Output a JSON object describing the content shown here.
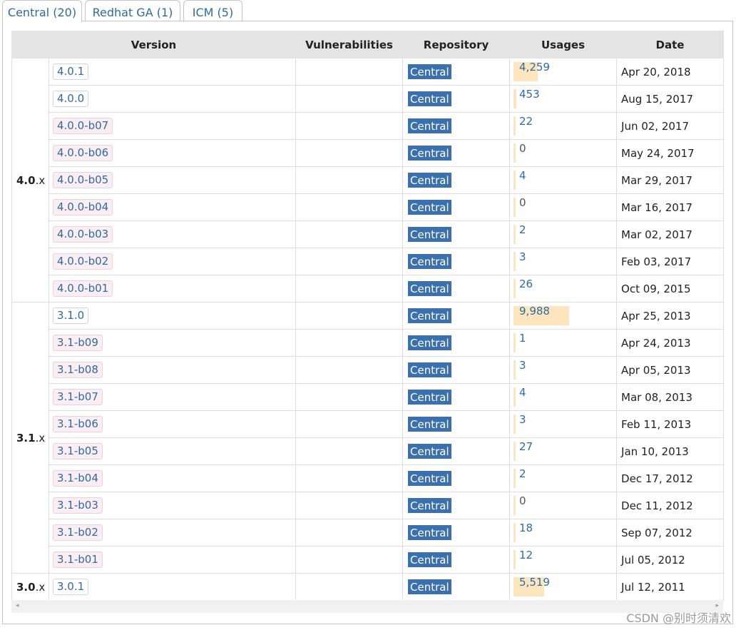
{
  "tabs": [
    {
      "label": "Central (20)"
    },
    {
      "label": "Redhat GA (1)"
    },
    {
      "label": "ICM (5)"
    }
  ],
  "columns": {
    "version": "Version",
    "vulnerabilities": "Vulnerabilities",
    "repository": "Repository",
    "usages": "Usages",
    "date": "Date"
  },
  "groups": [
    {
      "major": "4.0",
      "suffix": ".x",
      "rows": [
        {
          "version": "4.0.1",
          "beta": false,
          "repo": "Central",
          "usages": "4,259",
          "usage_fraction": 0.43,
          "date": "Apr 20, 2018"
        },
        {
          "version": "4.0.0",
          "beta": false,
          "repo": "Central",
          "usages": "453",
          "usage_fraction": 0.045,
          "date": "Aug 15, 2017"
        },
        {
          "version": "4.0.0-b07",
          "beta": true,
          "repo": "Central",
          "usages": "22",
          "usage_fraction": 0.01,
          "date": "Jun 02, 2017"
        },
        {
          "version": "4.0.0-b06",
          "beta": true,
          "repo": "Central",
          "usages": "0",
          "usage_fraction": 0.01,
          "date": "May 24, 2017"
        },
        {
          "version": "4.0.0-b05",
          "beta": true,
          "repo": "Central",
          "usages": "4",
          "usage_fraction": 0.01,
          "date": "Mar 29, 2017"
        },
        {
          "version": "4.0.0-b04",
          "beta": true,
          "repo": "Central",
          "usages": "0",
          "usage_fraction": 0.01,
          "date": "Mar 16, 2017"
        },
        {
          "version": "4.0.0-b03",
          "beta": true,
          "repo": "Central",
          "usages": "2",
          "usage_fraction": 0.01,
          "date": "Mar 02, 2017"
        },
        {
          "version": "4.0.0-b02",
          "beta": true,
          "repo": "Central",
          "usages": "3",
          "usage_fraction": 0.01,
          "date": "Feb 03, 2017"
        },
        {
          "version": "4.0.0-b01",
          "beta": true,
          "repo": "Central",
          "usages": "26",
          "usage_fraction": 0.01,
          "date": "Oct 09, 2015"
        }
      ]
    },
    {
      "major": "3.1",
      "suffix": ".x",
      "rows": [
        {
          "version": "3.1.0",
          "beta": false,
          "repo": "Central",
          "usages": "9,988",
          "usage_fraction": 1.0,
          "date": "Apr 25, 2013"
        },
        {
          "version": "3.1-b09",
          "beta": true,
          "repo": "Central",
          "usages": "1",
          "usage_fraction": 0.01,
          "date": "Apr 24, 2013"
        },
        {
          "version": "3.1-b08",
          "beta": true,
          "repo": "Central",
          "usages": "3",
          "usage_fraction": 0.01,
          "date": "Apr 05, 2013"
        },
        {
          "version": "3.1-b07",
          "beta": true,
          "repo": "Central",
          "usages": "4",
          "usage_fraction": 0.01,
          "date": "Mar 08, 2013"
        },
        {
          "version": "3.1-b06",
          "beta": true,
          "repo": "Central",
          "usages": "3",
          "usage_fraction": 0.01,
          "date": "Feb 11, 2013"
        },
        {
          "version": "3.1-b05",
          "beta": true,
          "repo": "Central",
          "usages": "27",
          "usage_fraction": 0.01,
          "date": "Jan 10, 2013"
        },
        {
          "version": "3.1-b04",
          "beta": true,
          "repo": "Central",
          "usages": "2",
          "usage_fraction": 0.01,
          "date": "Dec 17, 2012"
        },
        {
          "version": "3.1-b03",
          "beta": true,
          "repo": "Central",
          "usages": "0",
          "usage_fraction": 0.01,
          "date": "Dec 11, 2012"
        },
        {
          "version": "3.1-b02",
          "beta": true,
          "repo": "Central",
          "usages": "18",
          "usage_fraction": 0.01,
          "date": "Sep 07, 2012"
        },
        {
          "version": "3.1-b01",
          "beta": true,
          "repo": "Central",
          "usages": "12",
          "usage_fraction": 0.01,
          "date": "Jul 05, 2012"
        }
      ]
    },
    {
      "major": "3.0",
      "suffix": ".x",
      "rows": [
        {
          "version": "3.0.1",
          "beta": false,
          "repo": "Central",
          "usages": "5,519",
          "usage_fraction": 0.55,
          "date": "Jul 12, 2011"
        }
      ]
    }
  ],
  "scroll": {
    "left_arrow": "◂",
    "right_arrow": "▸"
  },
  "watermark": "CSDN @别时须清欢",
  "colors": {
    "link": "#2d6aa6",
    "repo_badge": "#3a70ae",
    "usage_bar": "#fde6bd",
    "beta_badge": "#fbeef3"
  }
}
